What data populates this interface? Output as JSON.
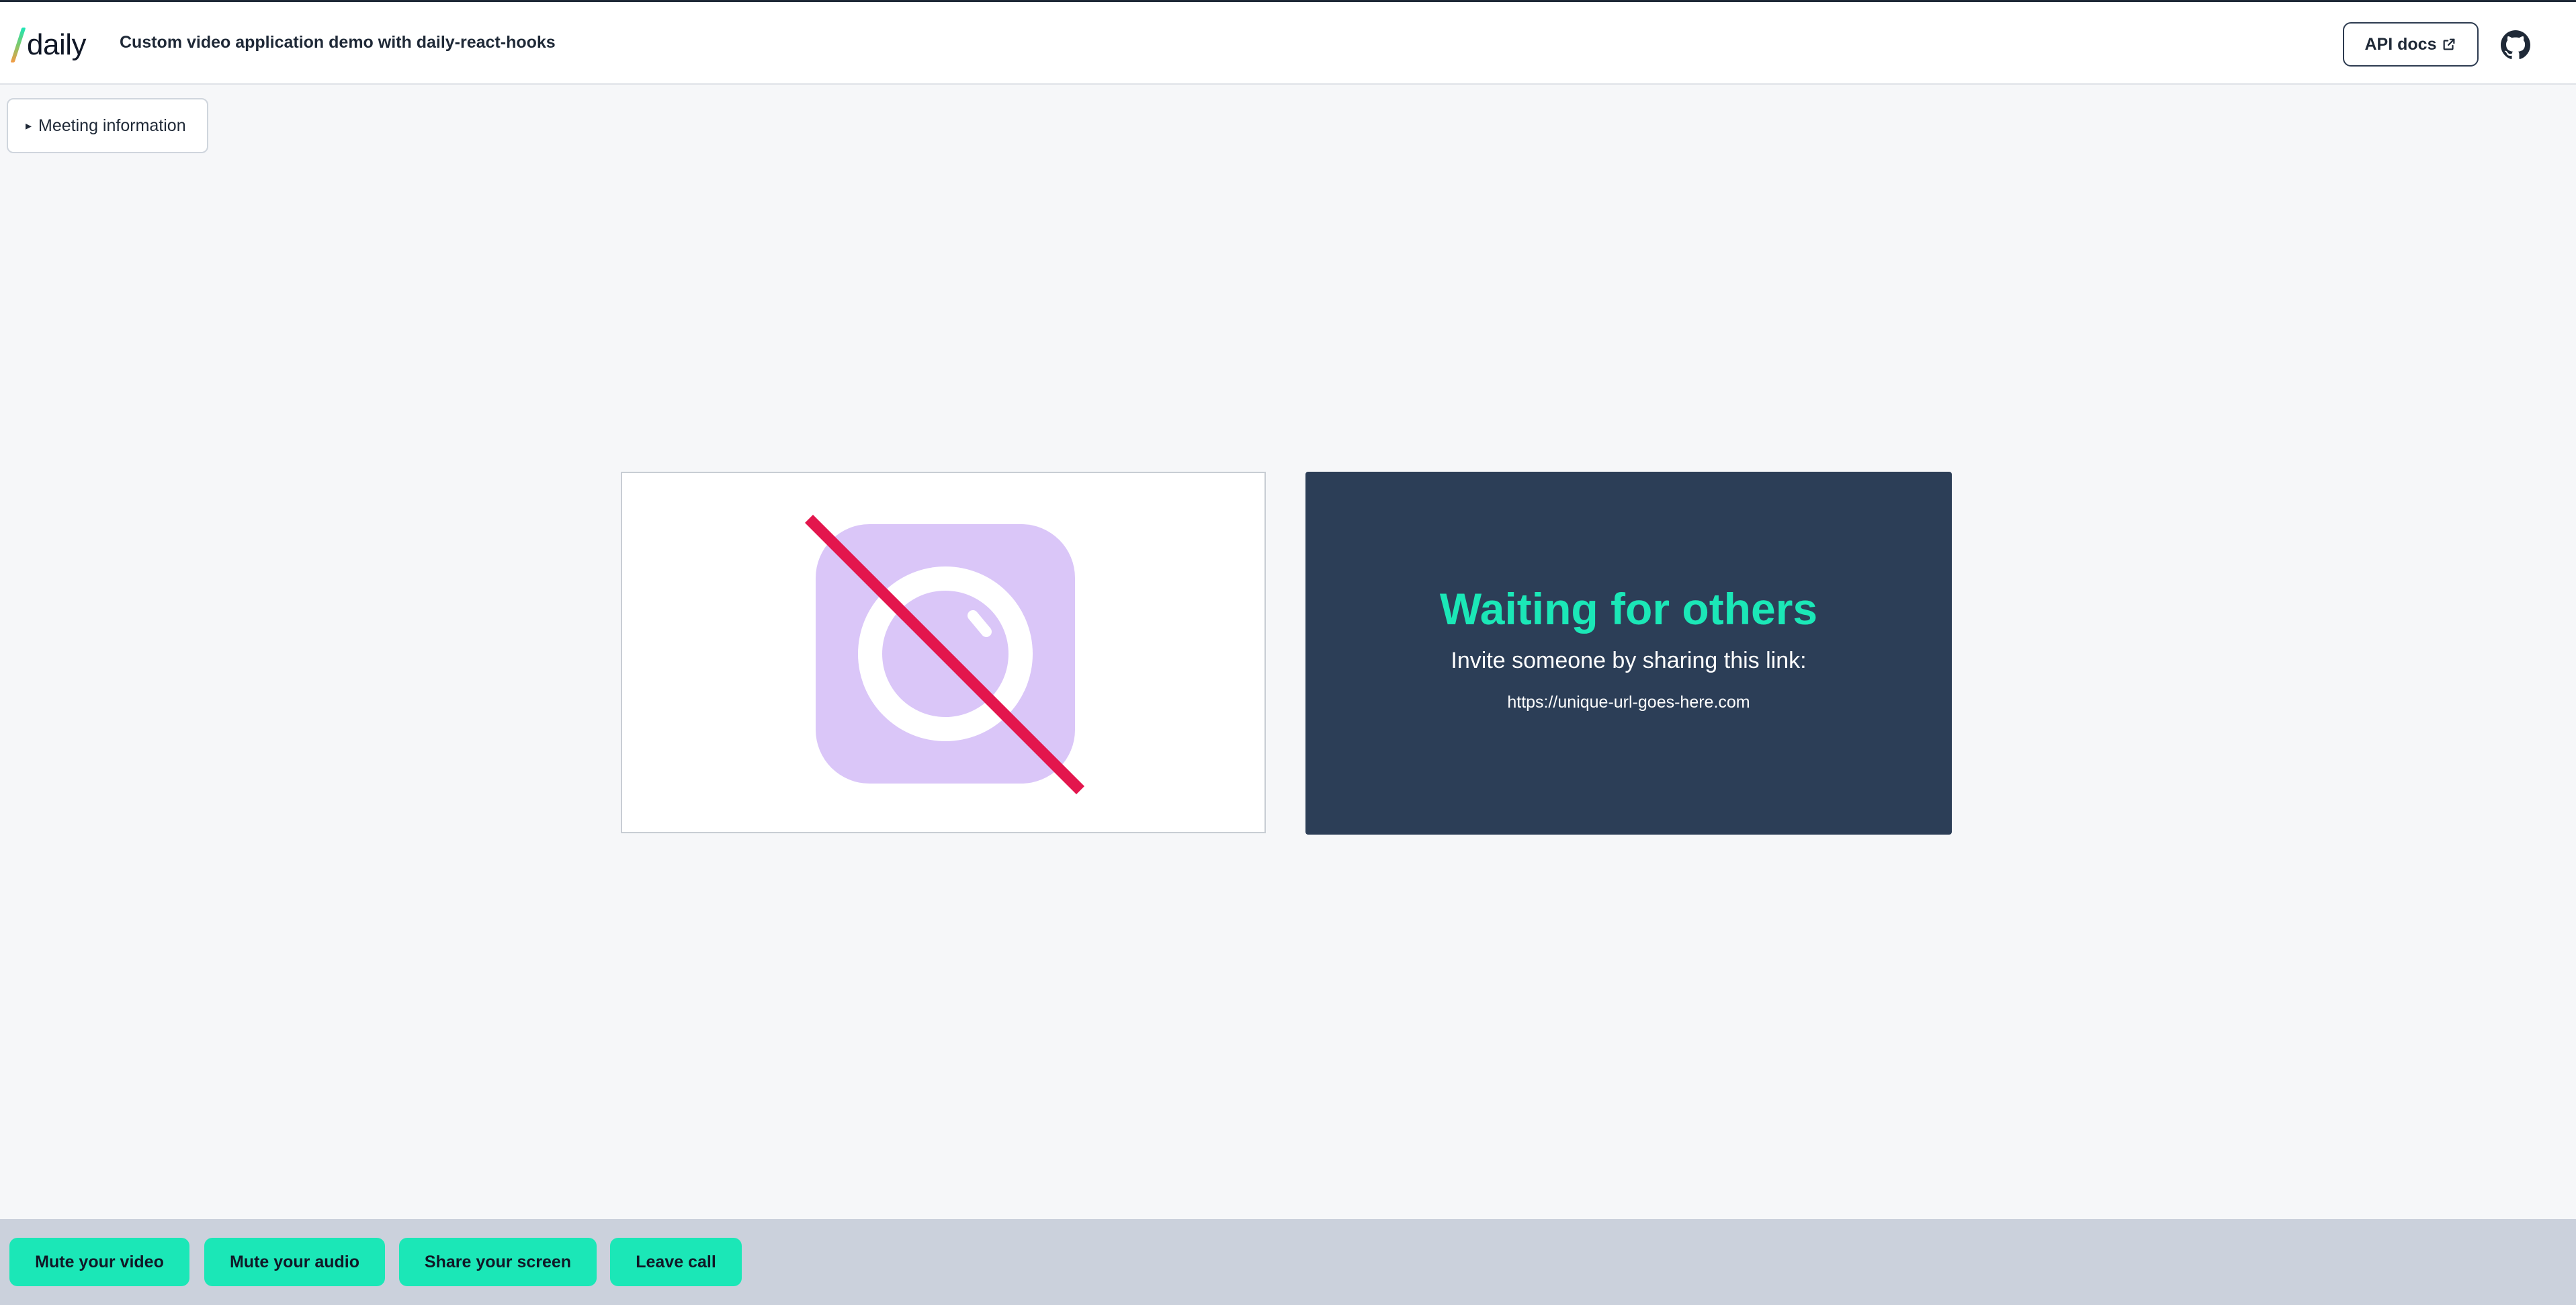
{
  "header": {
    "logo_text": "daily",
    "title": "Custom video application demo with daily-react-hooks",
    "api_docs_label": "API docs",
    "api_docs_icon": "external-link-icon",
    "github_icon": "github-icon"
  },
  "meeting_info": {
    "label": "Meeting information",
    "icon": "disclosure-triangle-icon"
  },
  "self_tile": {
    "icon": "camera-off-icon"
  },
  "waiting": {
    "title": "Waiting for others",
    "invite_text": "Invite someone by sharing this link:",
    "link": "https://unique-url-goes-here.com"
  },
  "tray": {
    "mute_video": "Mute your video",
    "mute_audio": "Mute your audio",
    "share_screen": "Share your screen",
    "leave_call": "Leave call"
  },
  "colors": {
    "accent": "#1be7b7",
    "waiting_bg": "#2c3e57",
    "camera_off_tile": "#dac6f8",
    "strike": "#e3164d",
    "tray_bg": "#cbd1dc"
  }
}
